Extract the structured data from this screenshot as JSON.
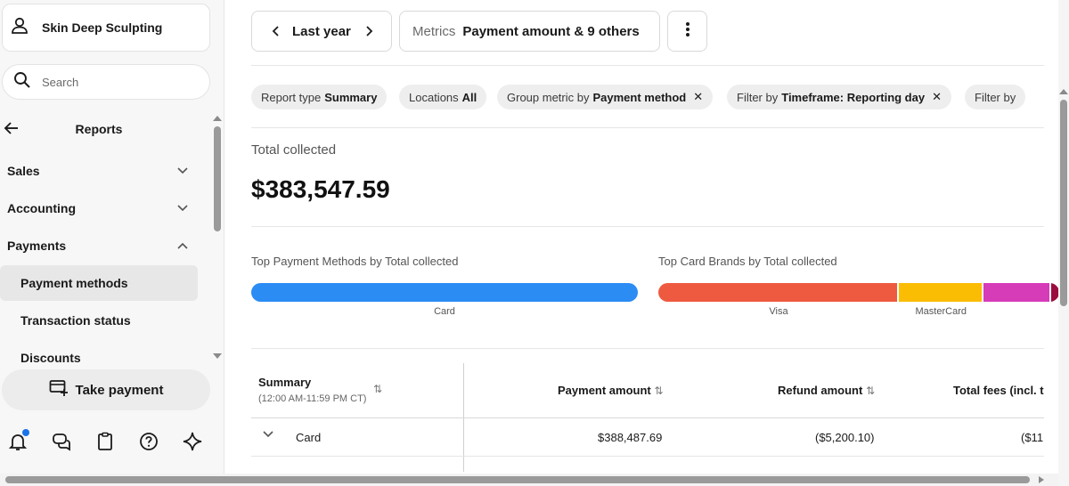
{
  "sidebar": {
    "account_name": "Skin Deep Sculpting",
    "search_placeholder": "Search",
    "section_title": "Reports",
    "nav": [
      {
        "label": "Sales",
        "expanded": false
      },
      {
        "label": "Accounting",
        "expanded": false
      },
      {
        "label": "Payments",
        "expanded": true
      }
    ],
    "sub_items": [
      {
        "label": "Payment methods",
        "active": true
      },
      {
        "label": "Transaction status",
        "active": false
      },
      {
        "label": "Discounts",
        "active": false
      }
    ],
    "take_payment": "Take payment",
    "footer_icons": [
      "bell-icon",
      "chat-icon",
      "clipboard-icon",
      "help-icon",
      "sparkle-icon"
    ]
  },
  "toolbar": {
    "date_range": "Last year",
    "metrics_label": "Metrics",
    "metrics_value": "Payment amount & 9 others"
  },
  "filters": [
    {
      "prefix": "Report type",
      "value": "Summary",
      "removable": false
    },
    {
      "prefix": "Locations",
      "value": "All",
      "removable": false
    },
    {
      "prefix": "Group metric by",
      "value": "Payment method",
      "removable": true
    },
    {
      "prefix": "Filter by",
      "value": "Timeframe: Reporting day",
      "removable": true
    },
    {
      "prefix": "Filter by",
      "value": "",
      "removable": false
    }
  ],
  "summary": {
    "total_label": "Total collected",
    "total_value": "$383,547.59"
  },
  "charts": {
    "methods_title": "Top Payment Methods by Total collected",
    "brands_title": "Top Card Brands by Total collected"
  },
  "chart_data": [
    {
      "type": "bar",
      "title": "Top Payment Methods by Total collected",
      "categories": [
        "Card"
      ],
      "values": [
        1.0
      ],
      "colors": [
        "#2b8cf4"
      ]
    },
    {
      "type": "bar",
      "title": "Top Card Brands by Total collected",
      "categories": [
        "Visa",
        "MasterCard",
        "",
        ""
      ],
      "values": [
        0.6,
        0.21,
        0.17,
        0.02
      ],
      "colors": [
        "#ee5a40",
        "#fbbc04",
        "#d63bb8",
        "#9b0d3e"
      ]
    }
  ],
  "table": {
    "summary_header": "Summary",
    "summary_sub": "(12:00 AM-11:59 PM CT)",
    "columns": [
      "Payment amount",
      "Refund amount",
      "Total fees (incl. t"
    ],
    "rows": [
      {
        "label": "Card",
        "payment_amount": "$388,487.69",
        "refund_amount": "($5,200.10)",
        "total_fees": "($11"
      }
    ]
  }
}
